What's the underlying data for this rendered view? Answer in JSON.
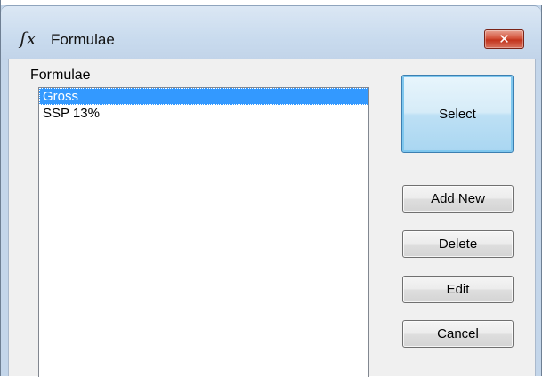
{
  "window": {
    "title": "Formulae",
    "title_icon": "fx-icon",
    "close_glyph": "✕"
  },
  "formulae_group": {
    "label": "Formulae"
  },
  "list": {
    "items": [
      {
        "label": "Gross",
        "selected": true
      },
      {
        "label": "SSP 13%",
        "selected": false
      }
    ]
  },
  "buttons": {
    "select": "Select",
    "add_new": "Add New",
    "delete": "Delete",
    "edit": "Edit",
    "cancel": "Cancel"
  },
  "colors": {
    "selection": "#3399ff",
    "close_button": "#c7412a",
    "default_button_border": "#3c7fb1"
  }
}
